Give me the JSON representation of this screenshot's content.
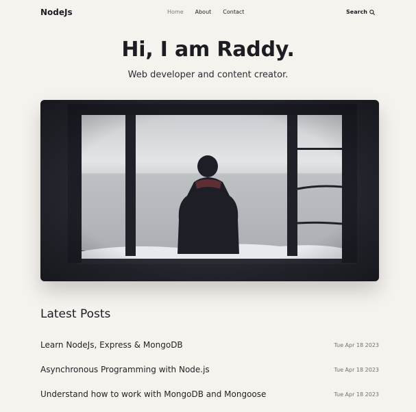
{
  "header": {
    "logo": "NodeJs",
    "nav": [
      "Home",
      "About",
      "Contact"
    ],
    "search_label": "Search"
  },
  "hero": {
    "title": "Hi, I am Raddy.",
    "subtitle": "Web developer and content creator."
  },
  "posts": {
    "heading": "Latest Posts",
    "items": [
      {
        "title": "Learn NodeJs, Express & MongoDB",
        "date": "Tue Apr 18 2023"
      },
      {
        "title": "Asynchronous Programming with Node.js",
        "date": "Tue Apr 18 2023"
      },
      {
        "title": "Understand how to work with MongoDB and Mongoose",
        "date": "Tue Apr 18 2023"
      }
    ]
  },
  "icons": {
    "search": "search-icon"
  }
}
